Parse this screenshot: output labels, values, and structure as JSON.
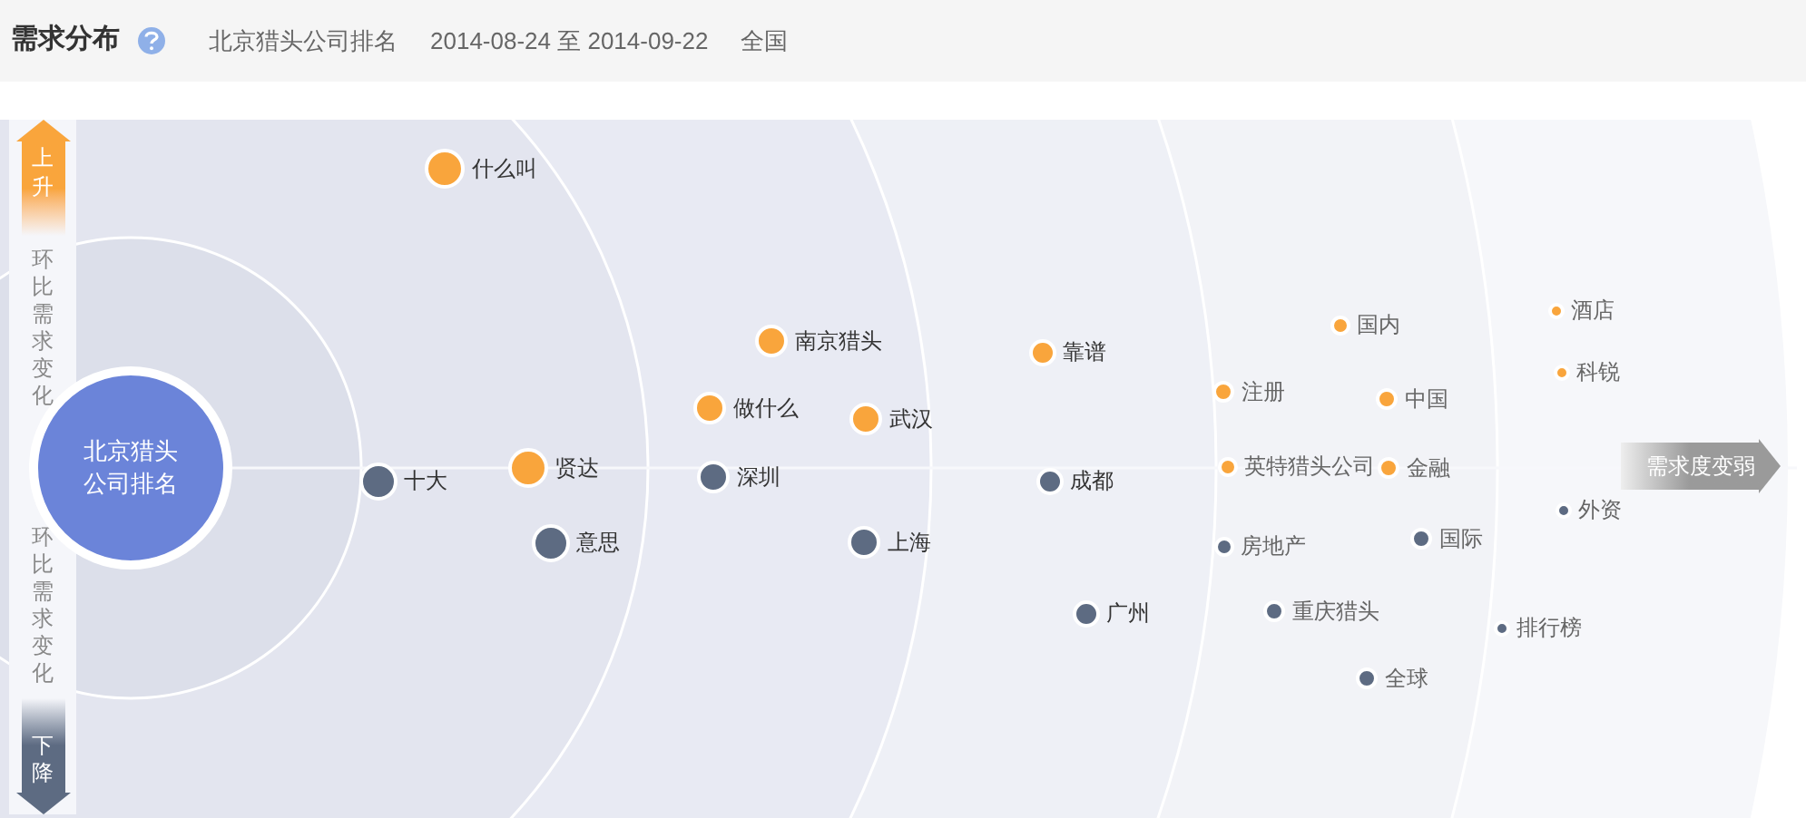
{
  "header": {
    "title": "需求分布",
    "keyword": "北京猎头公司排名",
    "date_range": "2014-08-24 至 2014-09-22",
    "region": "全国"
  },
  "chart": {
    "center_label": [
      "北京猎头",
      "公司排名"
    ],
    "up_label": "上升",
    "down_label": "下降",
    "side_label_top": "环比需求变化",
    "side_label_bottom": "环比需求变化",
    "weaker_label": "需求度变弱",
    "terms": [
      {
        "word": "什么叫",
        "color": "#f9a53c"
      },
      {
        "word": "十大",
        "color": "#5d6b82"
      },
      {
        "word": "贤达",
        "color": "#f9a53c"
      },
      {
        "word": "意思",
        "color": "#5d6b82"
      },
      {
        "word": "南京猎头",
        "color": "#f9a53c"
      },
      {
        "word": "做什么",
        "color": "#f9a53c"
      },
      {
        "word": "深圳",
        "color": "#5d6b82"
      },
      {
        "word": "武汉",
        "color": "#f9a53c"
      },
      {
        "word": "上海",
        "color": "#5d6b82"
      },
      {
        "word": "靠谱",
        "color": "#f9a53c"
      },
      {
        "word": "成都",
        "color": "#5d6b82"
      },
      {
        "word": "广州",
        "color": "#5d6b82"
      },
      {
        "word": "注册",
        "color": "#f9a53c"
      },
      {
        "word": "英特猎头公司",
        "color": "#f9a53c"
      },
      {
        "word": "房地产",
        "color": "#5d6b82"
      },
      {
        "word": "国内",
        "color": "#f9a53c"
      },
      {
        "word": "中国",
        "color": "#f9a53c"
      },
      {
        "word": "金融",
        "color": "#f9a53c"
      },
      {
        "word": "重庆猎头",
        "color": "#5d6b82"
      },
      {
        "word": "国际",
        "color": "#5d6b82"
      },
      {
        "word": "全球",
        "color": "#5d6b82"
      },
      {
        "word": "酒店",
        "color": "#f9a53c"
      },
      {
        "word": "科锐",
        "color": "#f9a53c"
      },
      {
        "word": "外资",
        "color": "#5d6b82"
      },
      {
        "word": "排行榜",
        "color": "#5d6b82"
      }
    ]
  }
}
